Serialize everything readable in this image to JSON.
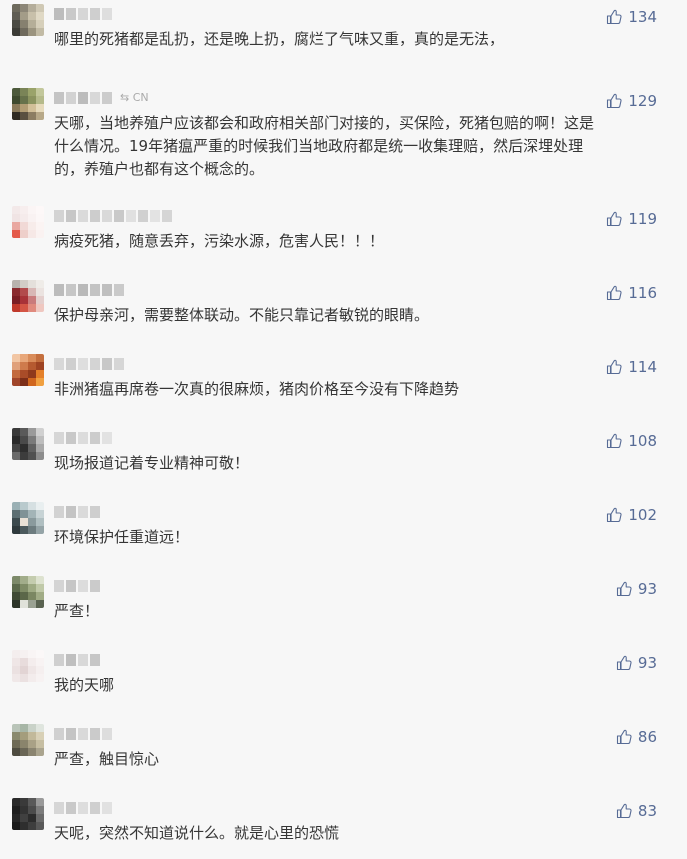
{
  "comments": [
    {
      "content": "哪里的死猪都是乱扔，还是晚上扔，腐烂了气味又重，真的是无法，",
      "likes": "134"
    },
    {
      "nick_tail": "⇆ CN",
      "content": "天哪，当地养殖户应该都会和政府相关部门对接的，买保险，死猪包赔的啊！这是\n什么情况。19年猪瘟严重的时候我们当地政府都是统一收集理赔，然后深埋处理\n的，养殖户也都有这个概念的。",
      "likes": "129"
    },
    {
      "content": "病疫死猪，随意丢弃，污染水源，危害人民！！！",
      "likes": "119"
    },
    {
      "content": "保护母亲河，需要整体联动。不能只靠记者敏锐的眼睛。",
      "likes": "116"
    },
    {
      "content": "非洲猪瘟再席卷一次真的很麻烦，猪肉价格至今没有下降趋势",
      "likes": "114"
    },
    {
      "content": "现场报道记着专业精神可敬！",
      "likes": "108"
    },
    {
      "content": "环境保护任重道远！",
      "likes": "102"
    },
    {
      "content": "严查！",
      "likes": "93"
    },
    {
      "content": "我的天哪",
      "likes": "93"
    },
    {
      "content": "严查，触目惊心",
      "likes": "86"
    },
    {
      "content": "天呢，突然不知道说什么。就是心里的恐慌",
      "likes": "83"
    }
  ],
  "icons": {
    "like": "thumbs-up-icon"
  },
  "colors": {
    "like": "#576b95",
    "text": "#353535",
    "background": "#f7f7f7"
  }
}
